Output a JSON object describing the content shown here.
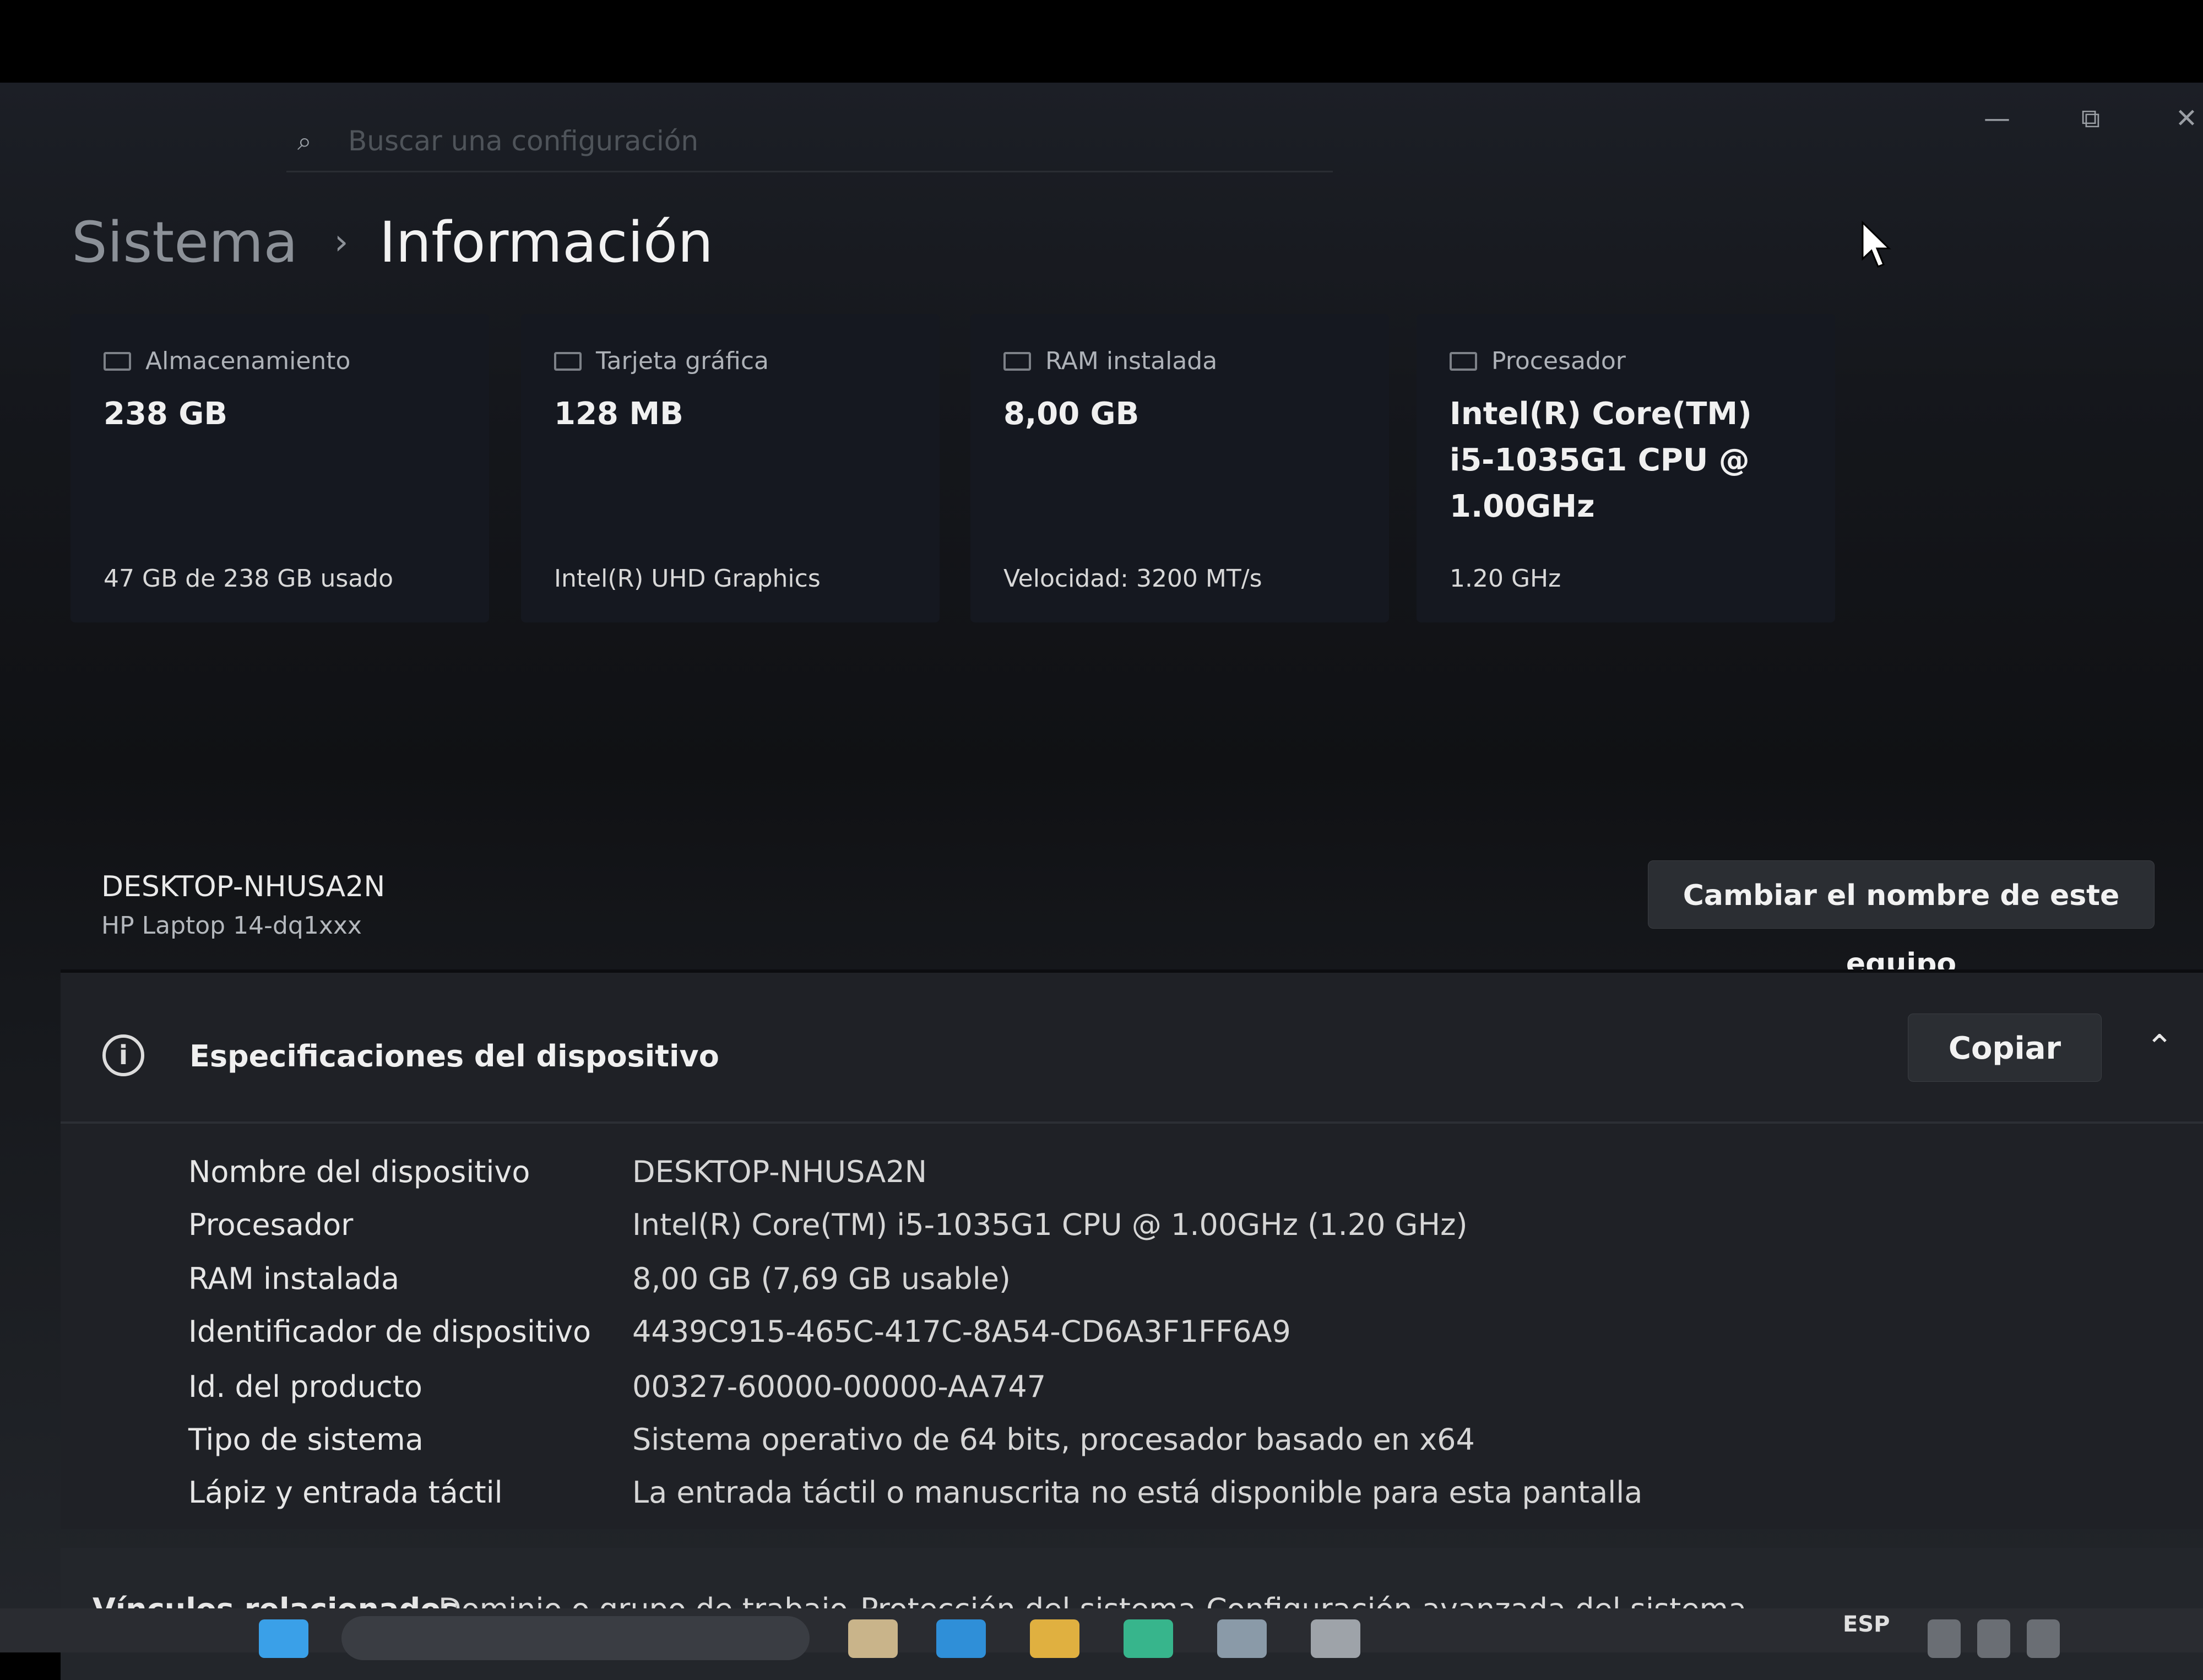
{
  "search": {
    "placeholder": "Buscar una configuración"
  },
  "breadcrumb": {
    "parent": "Sistema",
    "separator": "›",
    "current": "Información"
  },
  "window_controls": {
    "minimize": "—",
    "maximize": "⧉",
    "close": "✕"
  },
  "cards": [
    {
      "title": "Almacenamiento",
      "value": "238 GB",
      "sub": "47 GB de 238 GB usado"
    },
    {
      "title": "Tarjeta gráfica",
      "value": "128 MB",
      "sub": "Intel(R) UHD Graphics"
    },
    {
      "title": "RAM instalada",
      "value": "8,00 GB",
      "sub": "Velocidad: 3200 MT/s"
    },
    {
      "title": "Procesador",
      "value_lines": [
        "Intel(R) Core(TM)",
        "i5-1035G1 CPU @",
        "1.00GHz"
      ],
      "sub": "1.20 GHz"
    }
  ],
  "device": {
    "name": "DESKTOP-NHUSA2N",
    "model": "HP Laptop 14-dq1xxx",
    "rename_button": "Cambiar el nombre de este equipo"
  },
  "specs": {
    "title": "Especificaciones del dispositivo",
    "copy_button": "Copiar",
    "rows": [
      {
        "label": "Nombre del dispositivo",
        "value": "DESKTOP-NHUSA2N"
      },
      {
        "label": "Procesador",
        "value": "Intel(R) Core(TM) i5-1035G1 CPU @ 1.00GHz (1.20 GHz)"
      },
      {
        "label": "RAM instalada",
        "value": "8,00 GB (7,69 GB usable)"
      },
      {
        "label": "Identificador de dispositivo",
        "value": "4439C915-465C-417C-8A54-CD6A3F1FF6A9"
      },
      {
        "label": "Id. del producto",
        "value": "00327-60000-00000-AA747"
      },
      {
        "label": "Tipo de sistema",
        "value": "Sistema operativo de 64 bits, procesador basado en x64"
      },
      {
        "label": "Lápiz y entrada táctil",
        "value": "La entrada táctil o manuscrita no está disponible para esta pantalla"
      }
    ]
  },
  "related": {
    "label": "Vínculos relacionados",
    "links": [
      "Dominio o grupo de trabajo",
      "Protección del sistema",
      "Configuración avanzada del sistema"
    ]
  },
  "taskbar": {
    "language": "ESP"
  }
}
